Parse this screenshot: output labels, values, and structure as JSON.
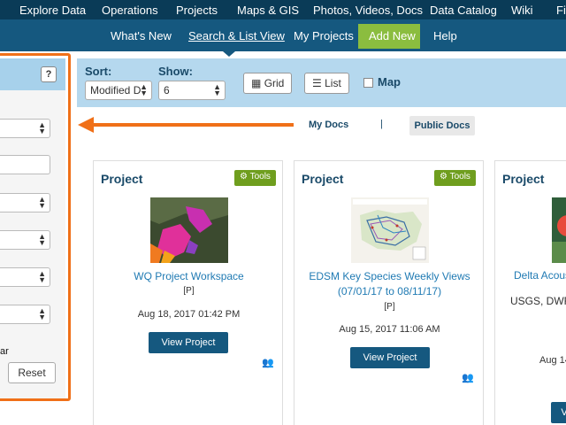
{
  "topnav": {
    "items": [
      "Explore Data",
      "Operations",
      "Projects",
      "Maps & GIS",
      "Photos, Videos, Docs",
      "Data Catalog",
      "Wiki",
      "Fi"
    ]
  },
  "subnav": {
    "items": [
      "What's New",
      "Search & List View",
      "My Projects",
      "Add New",
      "Help"
    ],
    "active": "Search & List View"
  },
  "leftpanel": {
    "help_label": "?",
    "partial_label": "ar",
    "reset_label": "Reset"
  },
  "toolbar": {
    "sort_label": "Sort:",
    "sort_value": "Modified D",
    "show_label": "Show:",
    "show_value": "6",
    "grid_label": "Grid",
    "list_label": "List",
    "map_label": "Map"
  },
  "doctabs": {
    "my_docs": "My Docs",
    "separator": "|",
    "public_docs": "Public Docs"
  },
  "cards": [
    {
      "type": "Project",
      "tools_label": "Tools",
      "title_lines": [
        "WQ Project Workspace"
      ],
      "tag": "[P]",
      "date": "Aug 18, 2017 01:42 PM",
      "button": "View Project"
    },
    {
      "type": "Project",
      "tools_label": "Tools",
      "title_lines": [
        "EDSM Key Species Weekly Views",
        "(07/01/17 to 08/11/17)"
      ],
      "tag": "[P]",
      "date": "Aug 15, 2017 11:06 AM",
      "button": "View Project"
    },
    {
      "type": "Project",
      "title_lines": [
        "Delta Acous"
      ],
      "meta": "USGS, DWR,",
      "date": "Aug 14"
    }
  ]
}
